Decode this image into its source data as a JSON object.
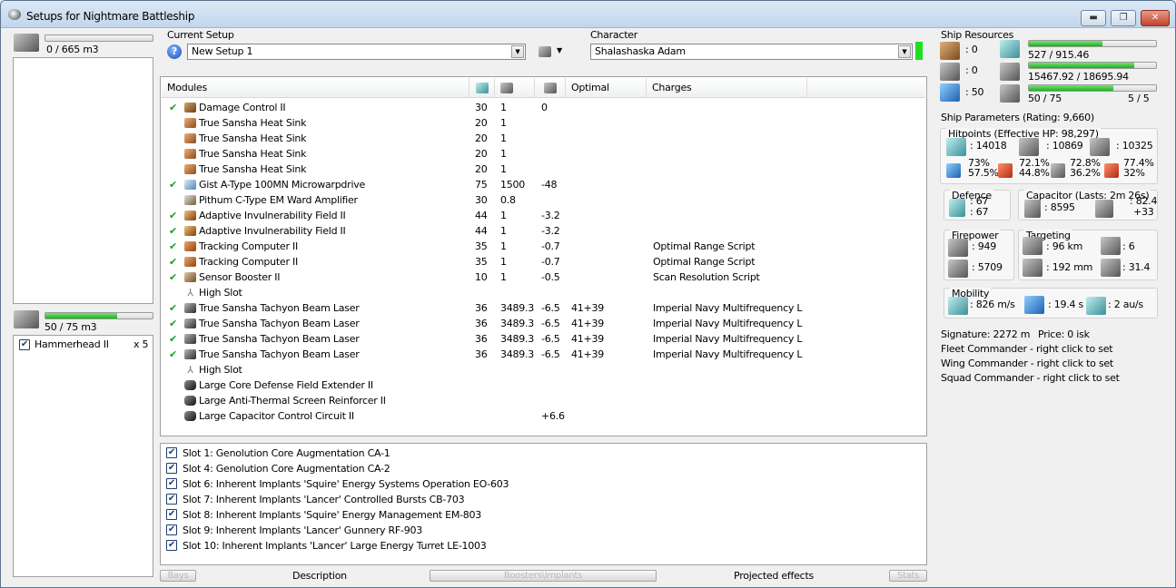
{
  "window": {
    "title": "Setups for Nightmare Battleship",
    "buttons": {
      "minimize": "▬",
      "maximize": "❐",
      "close": "✕"
    }
  },
  "cargo": {
    "volume": "0 / 665 m3",
    "fill_fraction": 0.0
  },
  "drones": {
    "volume": "50 / 75 m3",
    "fill_fraction": 0.667,
    "items": [
      {
        "name": "Hammerhead II",
        "qty": "x 5",
        "checked": true
      }
    ]
  },
  "setup": {
    "label": "Current Setup",
    "value": "New Setup 1",
    "help_glyph": "?"
  },
  "character": {
    "label": "Character",
    "value": "Shalashaska Adam"
  },
  "modules_table": {
    "headers": {
      "modules": "Modules",
      "optimal": "Optimal",
      "charges": "Charges"
    },
    "rows": [
      {
        "check": "✔",
        "icon": "damage",
        "name": "Damage Control II",
        "cpu": "30",
        "pg": "1",
        "cap": "0",
        "optimal": "",
        "charges": ""
      },
      {
        "check": "",
        "icon": "heatsink",
        "name": "True Sansha Heat Sink",
        "cpu": "20",
        "pg": "1",
        "cap": "",
        "optimal": "",
        "charges": ""
      },
      {
        "check": "",
        "icon": "heatsink",
        "name": "True Sansha Heat Sink",
        "cpu": "20",
        "pg": "1",
        "cap": "",
        "optimal": "",
        "charges": ""
      },
      {
        "check": "",
        "icon": "heatsink",
        "name": "True Sansha Heat Sink",
        "cpu": "20",
        "pg": "1",
        "cap": "",
        "optimal": "",
        "charges": ""
      },
      {
        "check": "",
        "icon": "heatsink",
        "name": "True Sansha Heat Sink",
        "cpu": "20",
        "pg": "1",
        "cap": "",
        "optimal": "",
        "charges": ""
      },
      {
        "check": "✔",
        "icon": "mwd",
        "name": "Gist A-Type 100MN Microwarpdrive",
        "cpu": "75",
        "pg": "1500",
        "cap": "-48",
        "optimal": "",
        "charges": ""
      },
      {
        "check": "",
        "icon": "ward",
        "name": "Pithum C-Type EM Ward Amplifier",
        "cpu": "30",
        "pg": "0.8",
        "cap": "",
        "optimal": "",
        "charges": ""
      },
      {
        "check": "✔",
        "icon": "invuln",
        "name": "Adaptive Invulnerability Field II",
        "cpu": "44",
        "pg": "1",
        "cap": "-3.2",
        "optimal": "",
        "charges": ""
      },
      {
        "check": "✔",
        "icon": "invuln",
        "name": "Adaptive Invulnerability Field II",
        "cpu": "44",
        "pg": "1",
        "cap": "-3.2",
        "optimal": "",
        "charges": ""
      },
      {
        "check": "✔",
        "icon": "track",
        "name": "Tracking Computer II",
        "cpu": "35",
        "pg": "1",
        "cap": "-0.7",
        "optimal": "",
        "charges": "Optimal Range Script"
      },
      {
        "check": "✔",
        "icon": "track",
        "name": "Tracking Computer II",
        "cpu": "35",
        "pg": "1",
        "cap": "-0.7",
        "optimal": "",
        "charges": "Optimal Range Script"
      },
      {
        "check": "✔",
        "icon": "sensor",
        "name": "Sensor Booster II",
        "cpu": "10",
        "pg": "1",
        "cap": "-0.5",
        "optimal": "",
        "charges": "Scan Resolution Script"
      },
      {
        "check": "",
        "icon": "slot",
        "name": "High Slot",
        "cpu": "",
        "pg": "",
        "cap": "",
        "optimal": "",
        "charges": ""
      },
      {
        "check": "✔",
        "icon": "laser",
        "name": "True Sansha Tachyon Beam Laser",
        "cpu": "36",
        "pg": "3489.3",
        "cap": "-6.5",
        "optimal": "41+39",
        "charges": "Imperial Navy Multifrequency L"
      },
      {
        "check": "✔",
        "icon": "laser",
        "name": "True Sansha Tachyon Beam Laser",
        "cpu": "36",
        "pg": "3489.3",
        "cap": "-6.5",
        "optimal": "41+39",
        "charges": "Imperial Navy Multifrequency L"
      },
      {
        "check": "✔",
        "icon": "laser",
        "name": "True Sansha Tachyon Beam Laser",
        "cpu": "36",
        "pg": "3489.3",
        "cap": "-6.5",
        "optimal": "41+39",
        "charges": "Imperial Navy Multifrequency L"
      },
      {
        "check": "✔",
        "icon": "laser",
        "name": "True Sansha Tachyon Beam Laser",
        "cpu": "36",
        "pg": "3489.3",
        "cap": "-6.5",
        "optimal": "41+39",
        "charges": "Imperial Navy Multifrequency L"
      },
      {
        "check": "",
        "icon": "slot",
        "name": "High Slot",
        "cpu": "",
        "pg": "",
        "cap": "",
        "optimal": "",
        "charges": ""
      },
      {
        "check": "",
        "icon": "rig",
        "name": "Large Core Defense Field Extender II",
        "cpu": "",
        "pg": "",
        "cap": "",
        "optimal": "",
        "charges": ""
      },
      {
        "check": "",
        "icon": "rig",
        "name": "Large Anti-Thermal Screen Reinforcer II",
        "cpu": "",
        "pg": "",
        "cap": "",
        "optimal": "",
        "charges": ""
      },
      {
        "check": "",
        "icon": "rig",
        "name": "Large Capacitor Control Circuit II",
        "cpu": "",
        "pg": "",
        "cap": "+6.6",
        "optimal": "",
        "charges": ""
      }
    ]
  },
  "implants": [
    "Slot 1: Genolution Core Augmentation CA-1",
    "Slot 4: Genolution Core Augmentation CA-2",
    "Slot 6: Inherent Implants 'Squire' Energy Systems Operation EO-603",
    "Slot 7: Inherent Implants 'Lancer' Controlled Bursts CB-703",
    "Slot 8: Inherent Implants 'Squire' Energy Management EM-803",
    "Slot 9: Inherent Implants 'Lancer' Gunnery RF-903",
    "Slot 10: Inherent Implants 'Lancer' Large Energy Turret LE-1003"
  ],
  "bottom_tabs": {
    "bays": "Bays",
    "description": "Description",
    "boosters": "Boosters\\Implants",
    "projected": "Projected effects",
    "stats": "Stats"
  },
  "ship_resources": {
    "label": "Ship Resources",
    "turret_hardpoints": ": 0",
    "launcher_hardpoints": ": 0",
    "calibration": ": 50",
    "cpu": {
      "text": "527 / 915.46",
      "fill_fraction": 0.576
    },
    "powergrid": {
      "text": "15467.92 / 18695.94",
      "fill_fraction": 0.827
    },
    "drone_bandwidth": {
      "text": "50 / 75",
      "fill_fraction": 0.667,
      "drones_active": "5 / 5"
    }
  },
  "ship_params": {
    "title": "Ship Parameters (Rating: 9,660)",
    "hitpoints": {
      "title": "Hitpoints (Effective HP: 98,297)",
      "shield": ": 14018",
      "armor": ": 10869",
      "hull": ": 10325",
      "em": [
        "73%",
        "57.5%"
      ],
      "thermal": [
        "72.1%",
        "44.8%"
      ],
      "kinetic": [
        "72.8%",
        "36.2%"
      ],
      "explosive": [
        "77.4%",
        "32%"
      ]
    },
    "defence": {
      "title": "Defence",
      "v1": ": 67",
      "v2": ": 67"
    },
    "capacitor": {
      "title": "Capacitor (Lasts: 2m 26s)",
      "capacity": ": 8595",
      "recharge_a": ": 82.4",
      "recharge_b": "+33"
    },
    "firepower": {
      "title": "Firepower",
      "turret": ": 949",
      "volley": ": 5709"
    },
    "targeting": {
      "title": "Targeting",
      "range": ": 96 km",
      "max_targets": ": 6",
      "resolution": ": 192 mm",
      "sensor": ": 31.4"
    },
    "mobility": {
      "title": "Mobility",
      "velocity": ": 826 m/s",
      "align": ": 19.4 s",
      "warp": ": 2 au/s"
    },
    "signature": "Signature: 2272 m",
    "price": "Price: 0 isk",
    "fleet": "Fleet Commander - right click to set",
    "wing": "Wing Commander - right click to set",
    "squad": "Squad Commander - right click to set"
  },
  "colors": {
    "accent_green": "#19b219",
    "window_border": "#5a7390",
    "check_green": "#1aa31a"
  }
}
